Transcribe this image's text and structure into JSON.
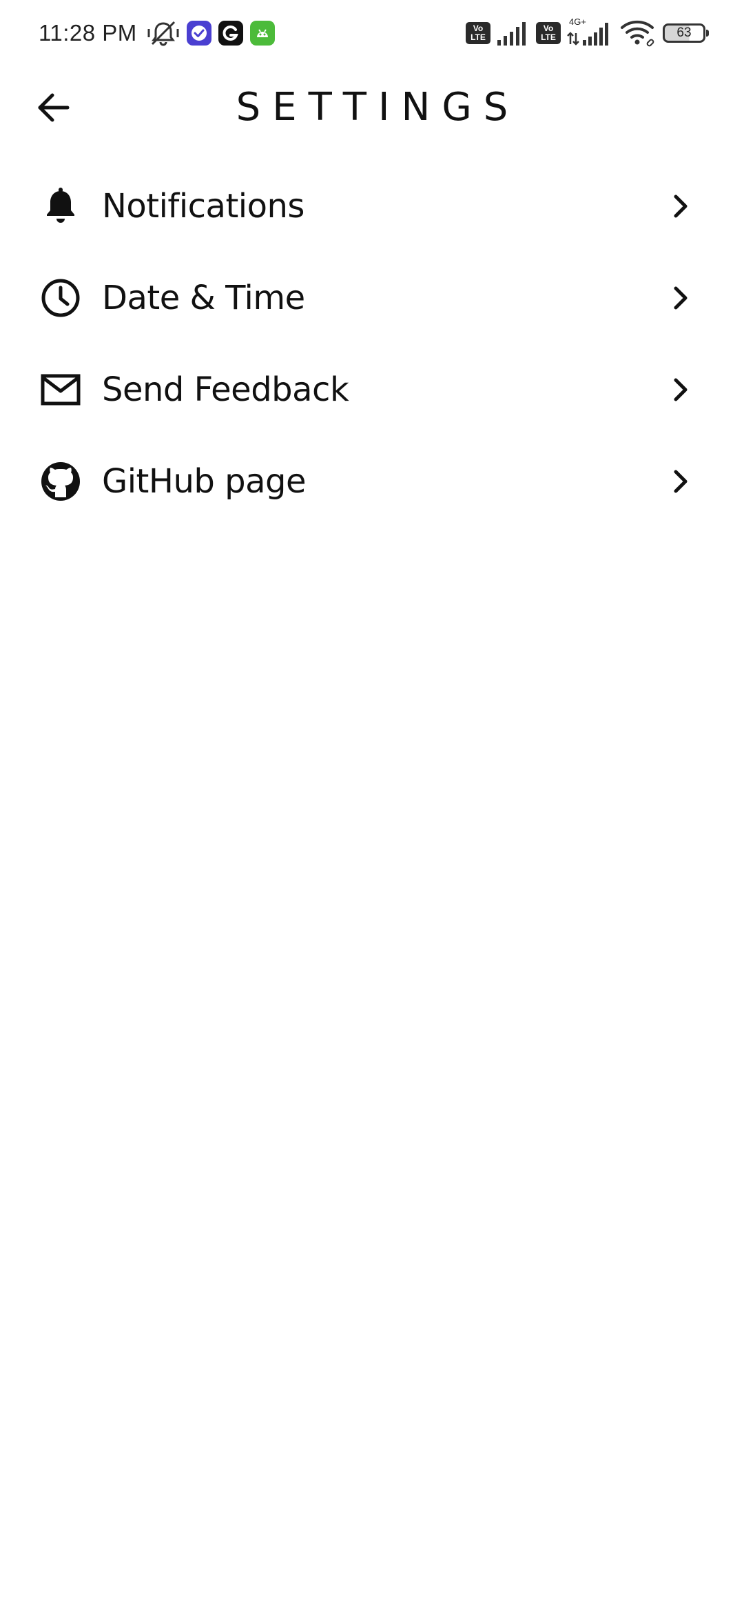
{
  "status_bar": {
    "time": "11:28 PM",
    "icons_left": [
      "vibrate-off-icon",
      "tasks-app-icon",
      "grammarly-app-icon",
      "android-app-icon"
    ],
    "volte_1": {
      "top": "Vo",
      "bottom": "LTE"
    },
    "volte_2": {
      "top": "Vo",
      "bottom": "LTE"
    },
    "network_type": "4G+",
    "battery_level": "63",
    "colors": {
      "tasks_badge": "#4a3fd1",
      "grammarly_badge": "#111111",
      "android_badge": "#4cbb3a"
    }
  },
  "header": {
    "title": "SETTINGS",
    "back_icon": "arrow-left-icon"
  },
  "settings": {
    "items": [
      {
        "label": "Notifications",
        "icon": "bell-icon"
      },
      {
        "label": "Date & Time",
        "icon": "clock-icon"
      },
      {
        "label": "Send Feedback",
        "icon": "mail-icon"
      },
      {
        "label": "GitHub page",
        "icon": "github-icon"
      }
    ]
  }
}
